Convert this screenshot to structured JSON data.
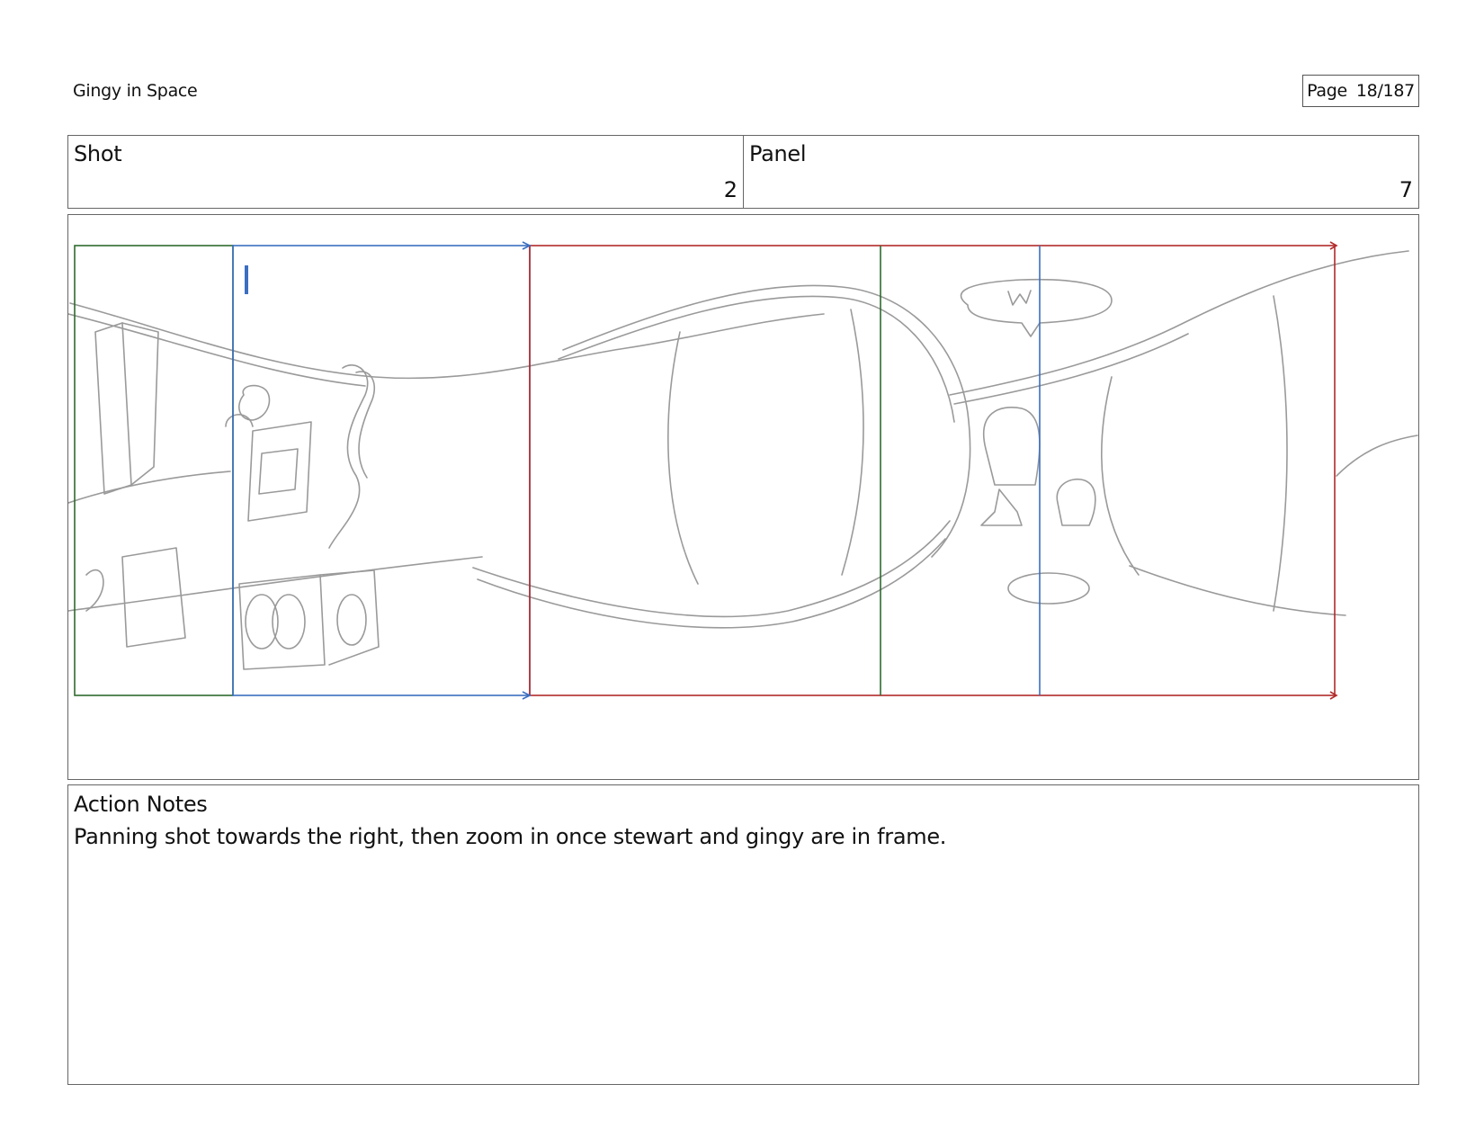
{
  "document": {
    "title": "Gingy in Space",
    "page_label": "Page",
    "page_value": "18/187"
  },
  "header": {
    "shot_label": "Shot",
    "shot_value": "2",
    "panel_label": "Panel",
    "panel_value": "7"
  },
  "frame": {
    "sketch_color": "#9a9a9a",
    "guide_green": "#2f6b2f",
    "guide_blue": "#3b6fc0",
    "guide_red": "#b22a2a"
  },
  "notes": {
    "label": "Action Notes",
    "text": "Panning shot towards the right, then zoom in once stewart and gingy are in frame."
  }
}
